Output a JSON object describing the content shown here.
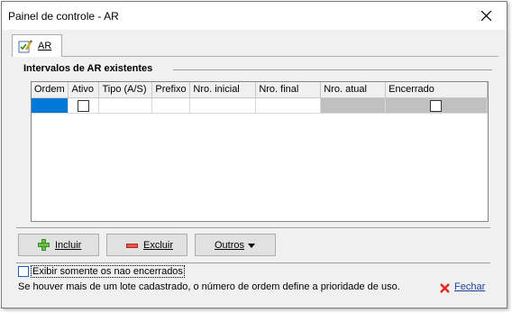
{
  "window": {
    "title": "Painel de controle - AR"
  },
  "tab": {
    "label": "AR"
  },
  "group": {
    "title": "Intervalos de AR existentes"
  },
  "grid": {
    "columns": [
      "Ordem",
      "Ativo",
      "Tipo (A/S)",
      "Prefixo",
      "Nro. inicial",
      "Nro. final",
      "Nro. atual",
      "Encerrado"
    ]
  },
  "buttons": {
    "incluir": "Incluir",
    "excluir": "Excluir",
    "outros": "Outros"
  },
  "options": {
    "only_open_label": "Exibir somente os nao encerrados"
  },
  "info": {
    "text": "Se houver mais de um lote cadastrado, o número de ordem define a prioridade de uso."
  },
  "footer": {
    "fechar": "Fechar"
  }
}
